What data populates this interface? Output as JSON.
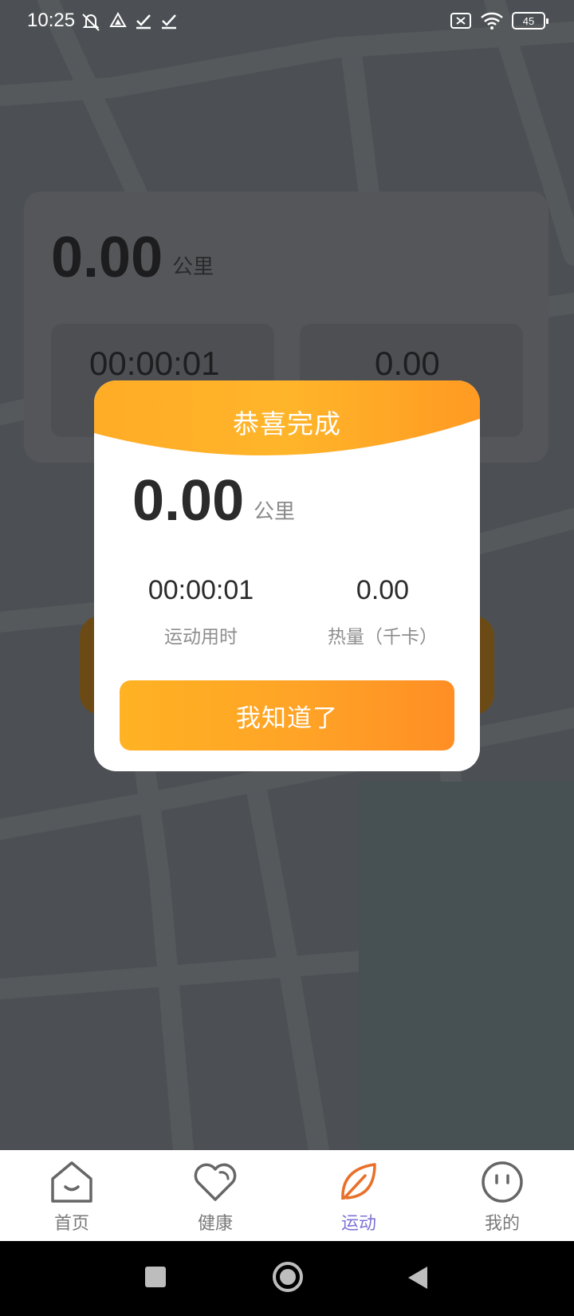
{
  "status_bar": {
    "time": "10:25",
    "battery": "45"
  },
  "background_card": {
    "distance": "0.00",
    "unit": "公里",
    "time": "00:00:01",
    "calories": "0.00"
  },
  "dialog": {
    "title": "恭喜完成",
    "distance": "0.00",
    "unit": "公里",
    "time_value": "00:00:01",
    "time_label": "运动用时",
    "calories_value": "0.00",
    "calories_label": "热量（千卡）",
    "confirm_label": "我知道了"
  },
  "bottom_nav": {
    "items": [
      {
        "label": "首页",
        "icon": "home-icon"
      },
      {
        "label": "健康",
        "icon": "heart-icon"
      },
      {
        "label": "运动",
        "icon": "leaf-icon",
        "active": true
      },
      {
        "label": "我的",
        "icon": "face-icon"
      }
    ]
  },
  "colors": {
    "accent": "#FFA326",
    "nav_active_label": "#7F73D6",
    "nav_active_icon": "#E8702A"
  }
}
